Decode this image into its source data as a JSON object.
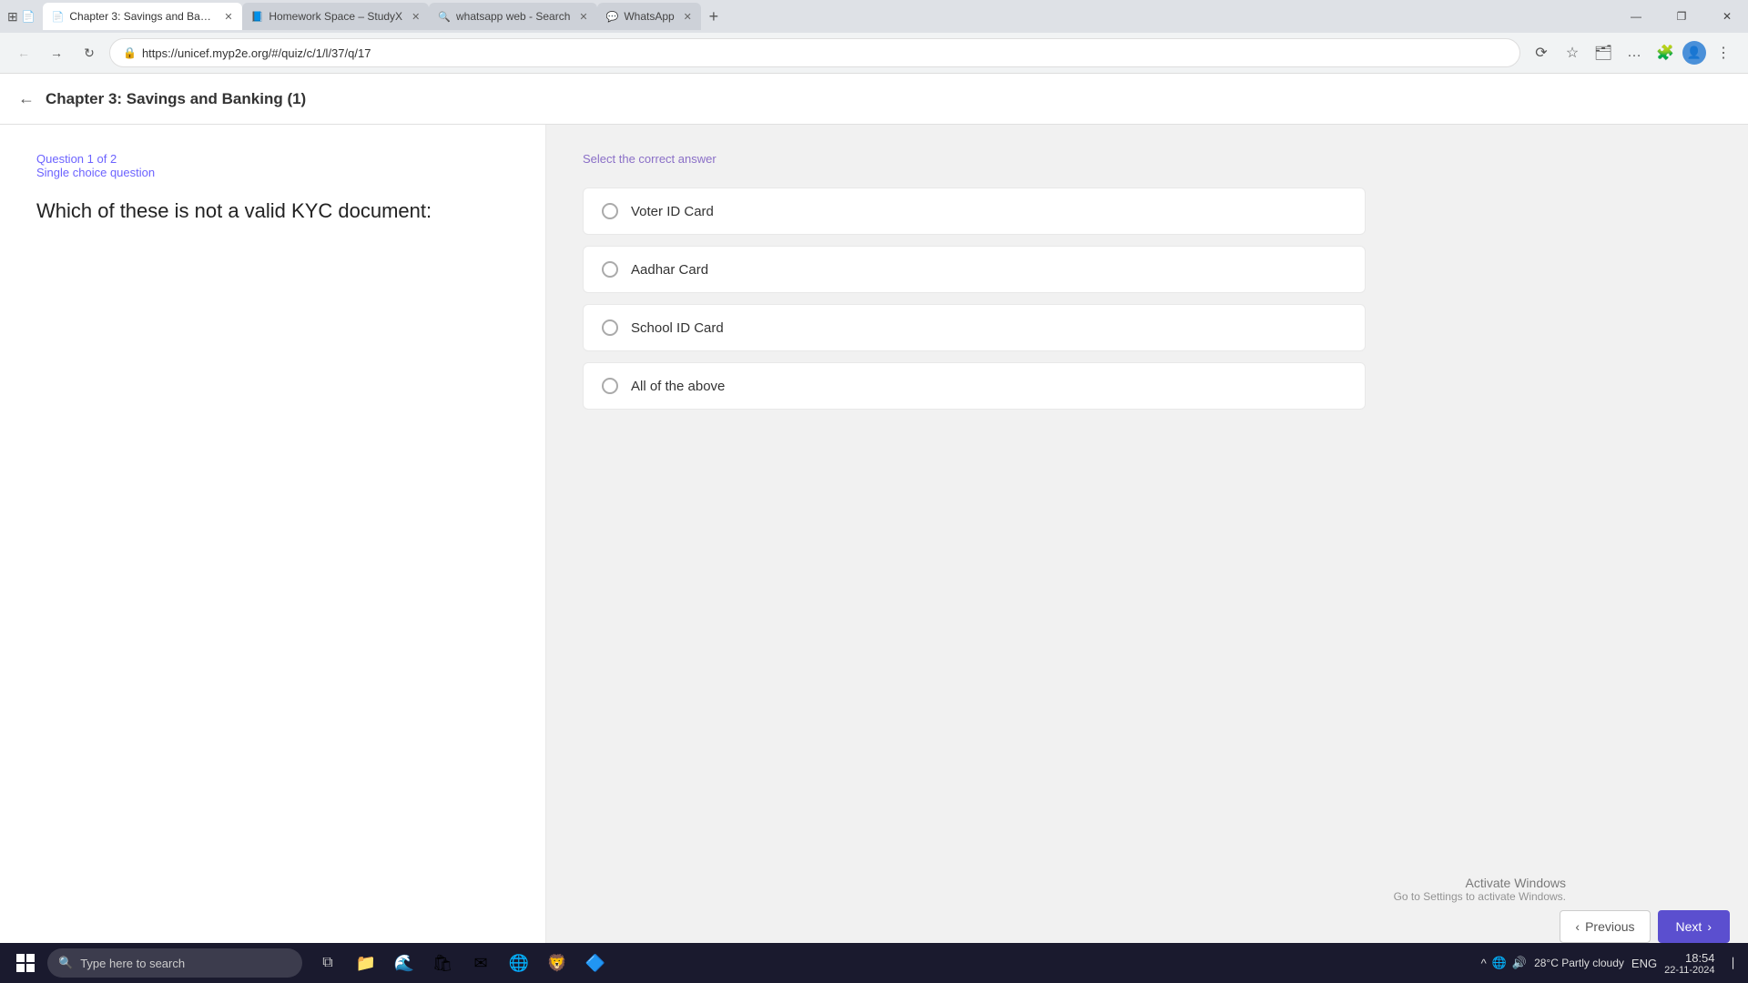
{
  "browser": {
    "tabs": [
      {
        "id": "tab1",
        "label": "Chapter 3: Savings and Banking ...",
        "active": true,
        "favicon": "📄",
        "url": "https://unicef.myp2e.org/#/quiz/c/1/l/37/q/17"
      },
      {
        "id": "tab2",
        "label": "Homework Space – StudyX",
        "active": false,
        "favicon": "📘"
      },
      {
        "id": "tab3",
        "label": "whatsapp web - Search",
        "active": false,
        "favicon": "🔍"
      },
      {
        "id": "tab4",
        "label": "WhatsApp",
        "active": false,
        "favicon": "💬"
      }
    ],
    "address": "https://unicef.myp2e.org/#/quiz/c/1/l/37/q/17"
  },
  "page": {
    "title": "Chapter 3: Savings and Banking (1)",
    "question_number": "Question 1 of 2",
    "question_type": "Single choice question",
    "question_text": "Which of these is not a valid KYC document:",
    "select_label": "Select the correct answer",
    "options": [
      {
        "id": "opt1",
        "text": "Voter ID Card",
        "selected": false
      },
      {
        "id": "opt2",
        "text": "Aadhar Card",
        "selected": false
      },
      {
        "id": "opt3",
        "text": "School ID Card",
        "selected": false
      },
      {
        "id": "opt4",
        "text": "All of the above",
        "selected": false
      }
    ],
    "prev_button": "Previous",
    "next_button": "Next"
  },
  "activate_windows": {
    "title": "Activate Windows",
    "subtitle": "Go to Settings to activate Windows."
  },
  "taskbar": {
    "search_placeholder": "Type here to search",
    "clock_time": "18:54",
    "clock_date": "22-11-2024",
    "language": "ENG",
    "weather": "28°C  Partly cloudy"
  }
}
